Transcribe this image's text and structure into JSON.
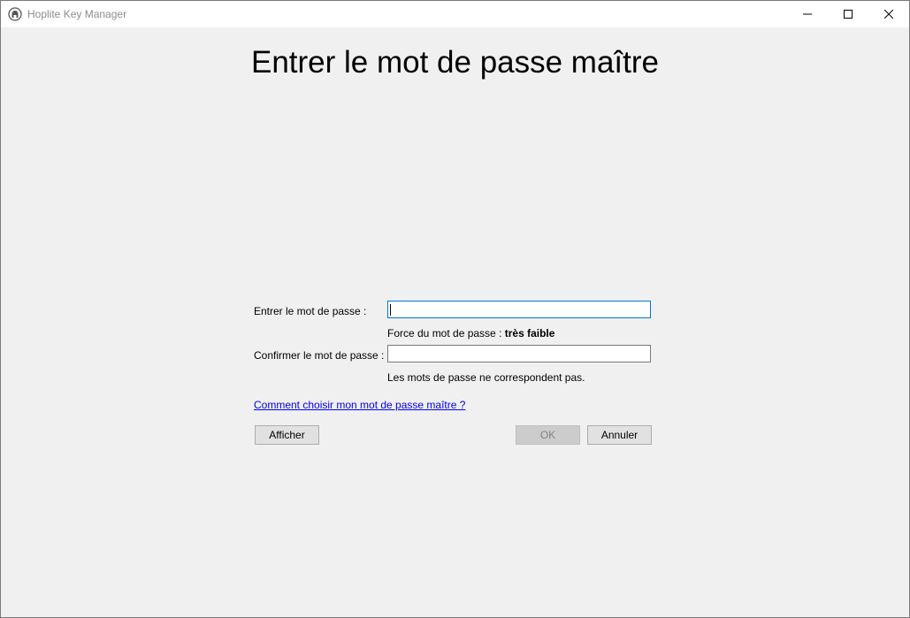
{
  "window": {
    "title": "Hoplite Key Manager",
    "icon": "hoplite-helmet-icon"
  },
  "titlebar_buttons": {
    "minimize_icon": "minimize-icon",
    "maximize_icon": "maximize-icon",
    "close_icon": "close-icon"
  },
  "dialog": {
    "heading": "Entrer le mot de passe maître",
    "password_label": "Entrer le mot de passe :",
    "password_value": "",
    "strength_prefix": "Force du mot de passe :",
    "strength_value": "très faible",
    "confirm_label": "Confirmer le mot de passe :",
    "confirm_value": "",
    "mismatch_message": "Les mots de passe ne correspondent pas.",
    "help_link": "Comment choisir mon mot de passe maître ?",
    "show_button": "Afficher",
    "ok_button": "OK",
    "cancel_button": "Annuler"
  },
  "colors": {
    "focus_border": "#0078d7",
    "link": "#0000ee",
    "background": "#f0f0f0"
  }
}
